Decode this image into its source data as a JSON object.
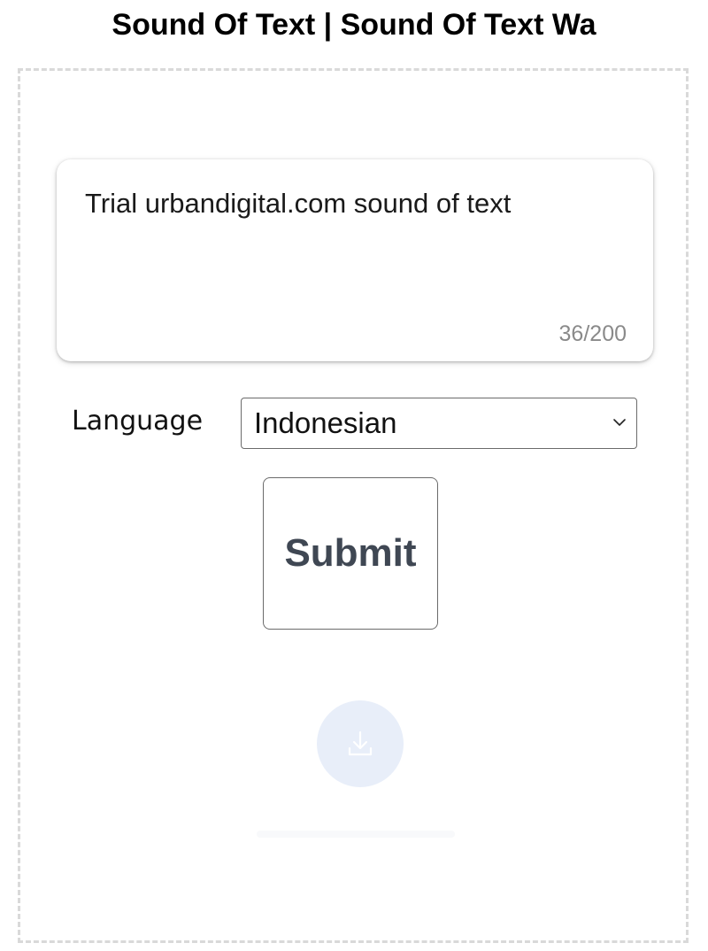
{
  "header": {
    "title": "Sound Of Text | Sound Of Text Wa"
  },
  "form": {
    "text_value": "Trial urbandigital.com sound of text",
    "char_count": "36/200",
    "language_label": "Language",
    "language_selected": "Indonesian",
    "submit_label": "Submit"
  },
  "icons": {
    "select_arrow": "chevron-down-icon",
    "download": "download-icon"
  },
  "colors": {
    "submit_text": "#3f4753",
    "download_bg": "#e8eef9",
    "download_icon": "#ffffff",
    "frame_border": "#d9d9d9"
  }
}
